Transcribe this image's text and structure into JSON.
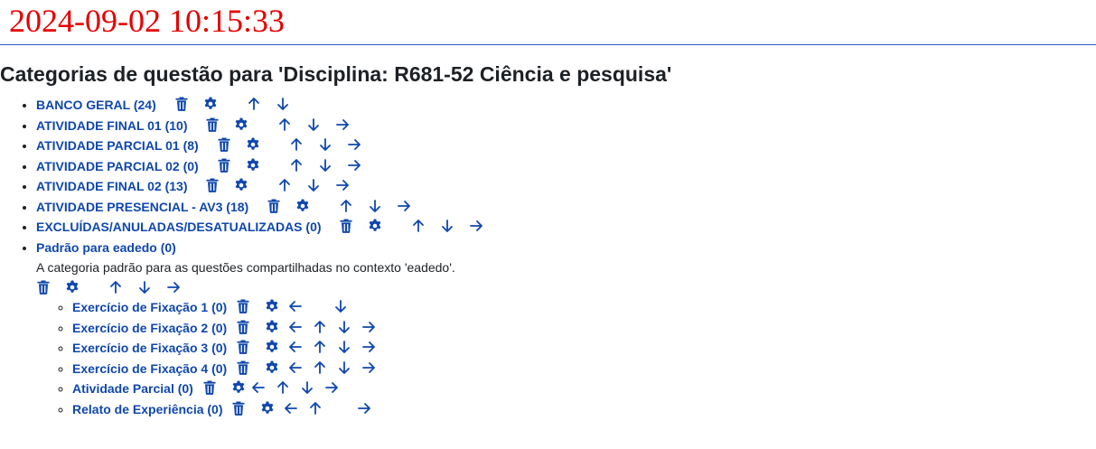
{
  "timestamp": "2024-09-02 10:15:33",
  "page_title": "Categorias de questão para 'Disciplina: R681-52 Ciência e pesquisa'",
  "accent_color": "#0f47ad",
  "timestamp_color": "#e60000",
  "categories": [
    {
      "label": "BANCO GERAL (24)",
      "actions": [
        "delete-icon",
        "settings-icon",
        "arrow-up-icon",
        "arrow-down-icon"
      ]
    },
    {
      "label": "ATIVIDADE FINAL 01 (10)",
      "actions": [
        "delete-icon",
        "settings-icon",
        "arrow-up-icon",
        "arrow-down-icon",
        "arrow-right-icon"
      ]
    },
    {
      "label": "ATIVIDADE PARCIAL 01 (8)",
      "actions": [
        "delete-icon",
        "settings-icon",
        "arrow-up-icon",
        "arrow-down-icon",
        "arrow-right-icon"
      ]
    },
    {
      "label": "ATIVIDADE PARCIAL 02 (0)",
      "actions": [
        "delete-icon",
        "settings-icon",
        "arrow-up-icon",
        "arrow-down-icon",
        "arrow-right-icon"
      ]
    },
    {
      "label": "ATIVIDADE FINAL 02 (13)",
      "actions": [
        "delete-icon",
        "settings-icon",
        "arrow-up-icon",
        "arrow-down-icon",
        "arrow-right-icon"
      ]
    },
    {
      "label": "ATIVIDADE PRESENCIAL - AV3 (18)",
      "actions": [
        "delete-icon",
        "settings-icon",
        "arrow-up-icon",
        "arrow-down-icon",
        "arrow-right-icon"
      ]
    },
    {
      "label": "EXCLUÍDAS/ANULADAS/DESATUALIZADAS (0)",
      "actions": [
        "delete-icon",
        "settings-icon",
        "arrow-up-icon",
        "arrow-down-icon",
        "arrow-right-icon"
      ]
    }
  ],
  "default_category": {
    "label": "Padrão para eadedo (0)",
    "description": "A categoria padrão para as questões compartilhadas no contexto 'eadedo'.",
    "actions": [
      "delete-icon",
      "settings-icon",
      "arrow-up-icon",
      "arrow-down-icon",
      "arrow-right-icon"
    ]
  },
  "subcategories": [
    {
      "label": "Exercício de Fixação 1 (0)"
    },
    {
      "label": "Exercício de Fixação 2 (0)"
    },
    {
      "label": "Exercício de Fixação 3 (0)"
    },
    {
      "label": "Exercício de Fixação 4 (0)"
    },
    {
      "label": "Atividade Parcial (0)"
    },
    {
      "label": "Relato de Experiência (0)"
    }
  ]
}
